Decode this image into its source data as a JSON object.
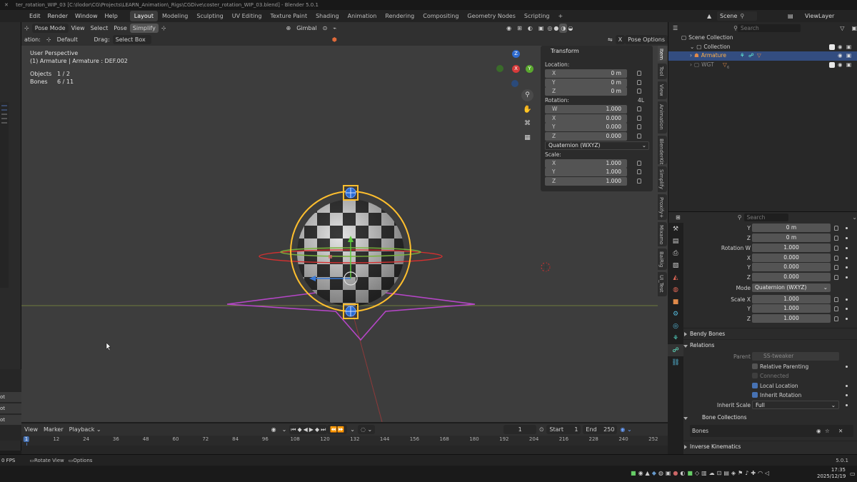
{
  "window": {
    "title": "ter_rotation_WIP_03 [C:\\Ilodor\\CG\\Projects\\LEARN_Animation\\_Rigs\\CGDive\\coster_rotation_WIP_03.blend] - Blender 5.0.1",
    "close_glyph": "✕"
  },
  "menu": {
    "items": [
      "Edit",
      "Render",
      "Window",
      "Help"
    ]
  },
  "workspaces": {
    "tabs": [
      "Layout",
      "Modeling",
      "Sculpting",
      "UV Editing",
      "Texture Paint",
      "Shading",
      "Animation",
      "Rendering",
      "Compositing",
      "Geometry Nodes",
      "Scripting"
    ],
    "active": "Layout",
    "add": "+"
  },
  "topright": {
    "scene": "Scene",
    "view_layer": "ViewLayer"
  },
  "viewport_header": {
    "mode": "Pose Mode",
    "view": "View",
    "select": "Select",
    "pose": "Pose",
    "simplify": "Simplify",
    "orientation": "Gimbal",
    "orientation_label": "ation:",
    "orientation_value": "Default",
    "drag_label": "Drag:",
    "drag_value": "Select Box",
    "pose_options": "Pose Options",
    "x_axis": "X"
  },
  "viewport_info": {
    "perspective": "User Perspective",
    "object": "(1) Armature | Armature : DEF.002",
    "objects_label": "Objects",
    "objects_value": "1 / 2",
    "bones_label": "Bones",
    "bones_value": "6 / 11"
  },
  "gizmo": {
    "x": "X",
    "y": "Y",
    "z": "Z"
  },
  "transform": {
    "title": "Transform",
    "location_label": "Location:",
    "location": [
      {
        "axis": "X",
        "value": "0 m"
      },
      {
        "axis": "Y",
        "value": "0 m"
      },
      {
        "axis": "Z",
        "value": "0 m"
      }
    ],
    "rotation_label": "Rotation:",
    "rotation_lock": "4L",
    "rotation": [
      {
        "axis": "W",
        "value": "1.000"
      },
      {
        "axis": "X",
        "value": "0.000"
      },
      {
        "axis": "Y",
        "value": "0.000"
      },
      {
        "axis": "Z",
        "value": "0.000"
      }
    ],
    "rotation_mode": "Quaternion (WXYZ)",
    "scale_label": "Scale:",
    "scale": [
      {
        "axis": "X",
        "value": "1.000"
      },
      {
        "axis": "Y",
        "value": "1.000"
      },
      {
        "axis": "Z",
        "value": "1.000"
      }
    ]
  },
  "side_tabs": [
    "Item",
    "Tool",
    "View",
    "Animation",
    "BlenderKit",
    "Simplify",
    "Proxify+",
    "Mixamo",
    "BaiRig",
    "UI_Test"
  ],
  "outliner": {
    "search_placeholder": "Search",
    "rows": [
      "Scene Collection",
      "Collection",
      "Armature",
      "WGT"
    ],
    "wgt_badge": "6"
  },
  "properties": {
    "search_placeholder": "Search",
    "location_rows": [
      {
        "label": "Y",
        "value": "0 m"
      },
      {
        "label": "Z",
        "value": "0 m"
      }
    ],
    "rotation_rows": [
      {
        "label": "Rotation W",
        "value": "1.000"
      },
      {
        "label": "X",
        "value": "0.000"
      },
      {
        "label": "Y",
        "value": "0.000"
      },
      {
        "label": "Z",
        "value": "0.000"
      }
    ],
    "mode_label": "Mode",
    "mode_value": "Quaternion (WXYZ)",
    "scale_rows": [
      {
        "label": "Scale X",
        "value": "1.000"
      },
      {
        "label": "Y",
        "value": "1.000"
      },
      {
        "label": "Z",
        "value": "1.000"
      }
    ],
    "bendy_bones": "Bendy Bones",
    "relations": "Relations",
    "parent_label": "Parent",
    "parent_value": "SS-tweaker",
    "relative_parenting": "Relative Parenting",
    "connected": "Connected",
    "local_location": "Local Location",
    "inherit_rotation": "Inherit Rotation",
    "inherit_scale_label": "Inherit Scale",
    "inherit_scale_value": "Full",
    "bone_collections": "Bone Collections",
    "bones_item": "Bones",
    "inverse_kinematics": "Inverse Kinematics"
  },
  "timeline": {
    "view": "View",
    "marker": "Marker",
    "playback": "Playback",
    "current_frame": "1",
    "start_label": "Start",
    "start": "1",
    "end_label": "End",
    "end": "250",
    "ticks": [
      "1",
      "12",
      "24",
      "36",
      "48",
      "60",
      "72",
      "84",
      "96",
      "108",
      "120",
      "132",
      "144",
      "156",
      "168",
      "180",
      "192",
      "204",
      "216",
      "228",
      "240",
      "252"
    ]
  },
  "statusbar": {
    "fps": "0 FPS",
    "rotate_view": "Rotate View",
    "options": "Options",
    "version": "5.0.1"
  },
  "taskbar": {
    "time": "17:35",
    "date": "2025/12/19"
  },
  "left_panel": {
    "items": [
      "ot",
      "ot",
      "ot"
    ]
  },
  "colors": {
    "accent": "#4772b3",
    "selected_row": "#334d80",
    "active_object": "#ffb04a",
    "bone_yellow": "#ffbf2e",
    "custom_shape_purple": "#b646c8",
    "ring_red": "#d63030",
    "ring_green": "#7bb33a"
  }
}
